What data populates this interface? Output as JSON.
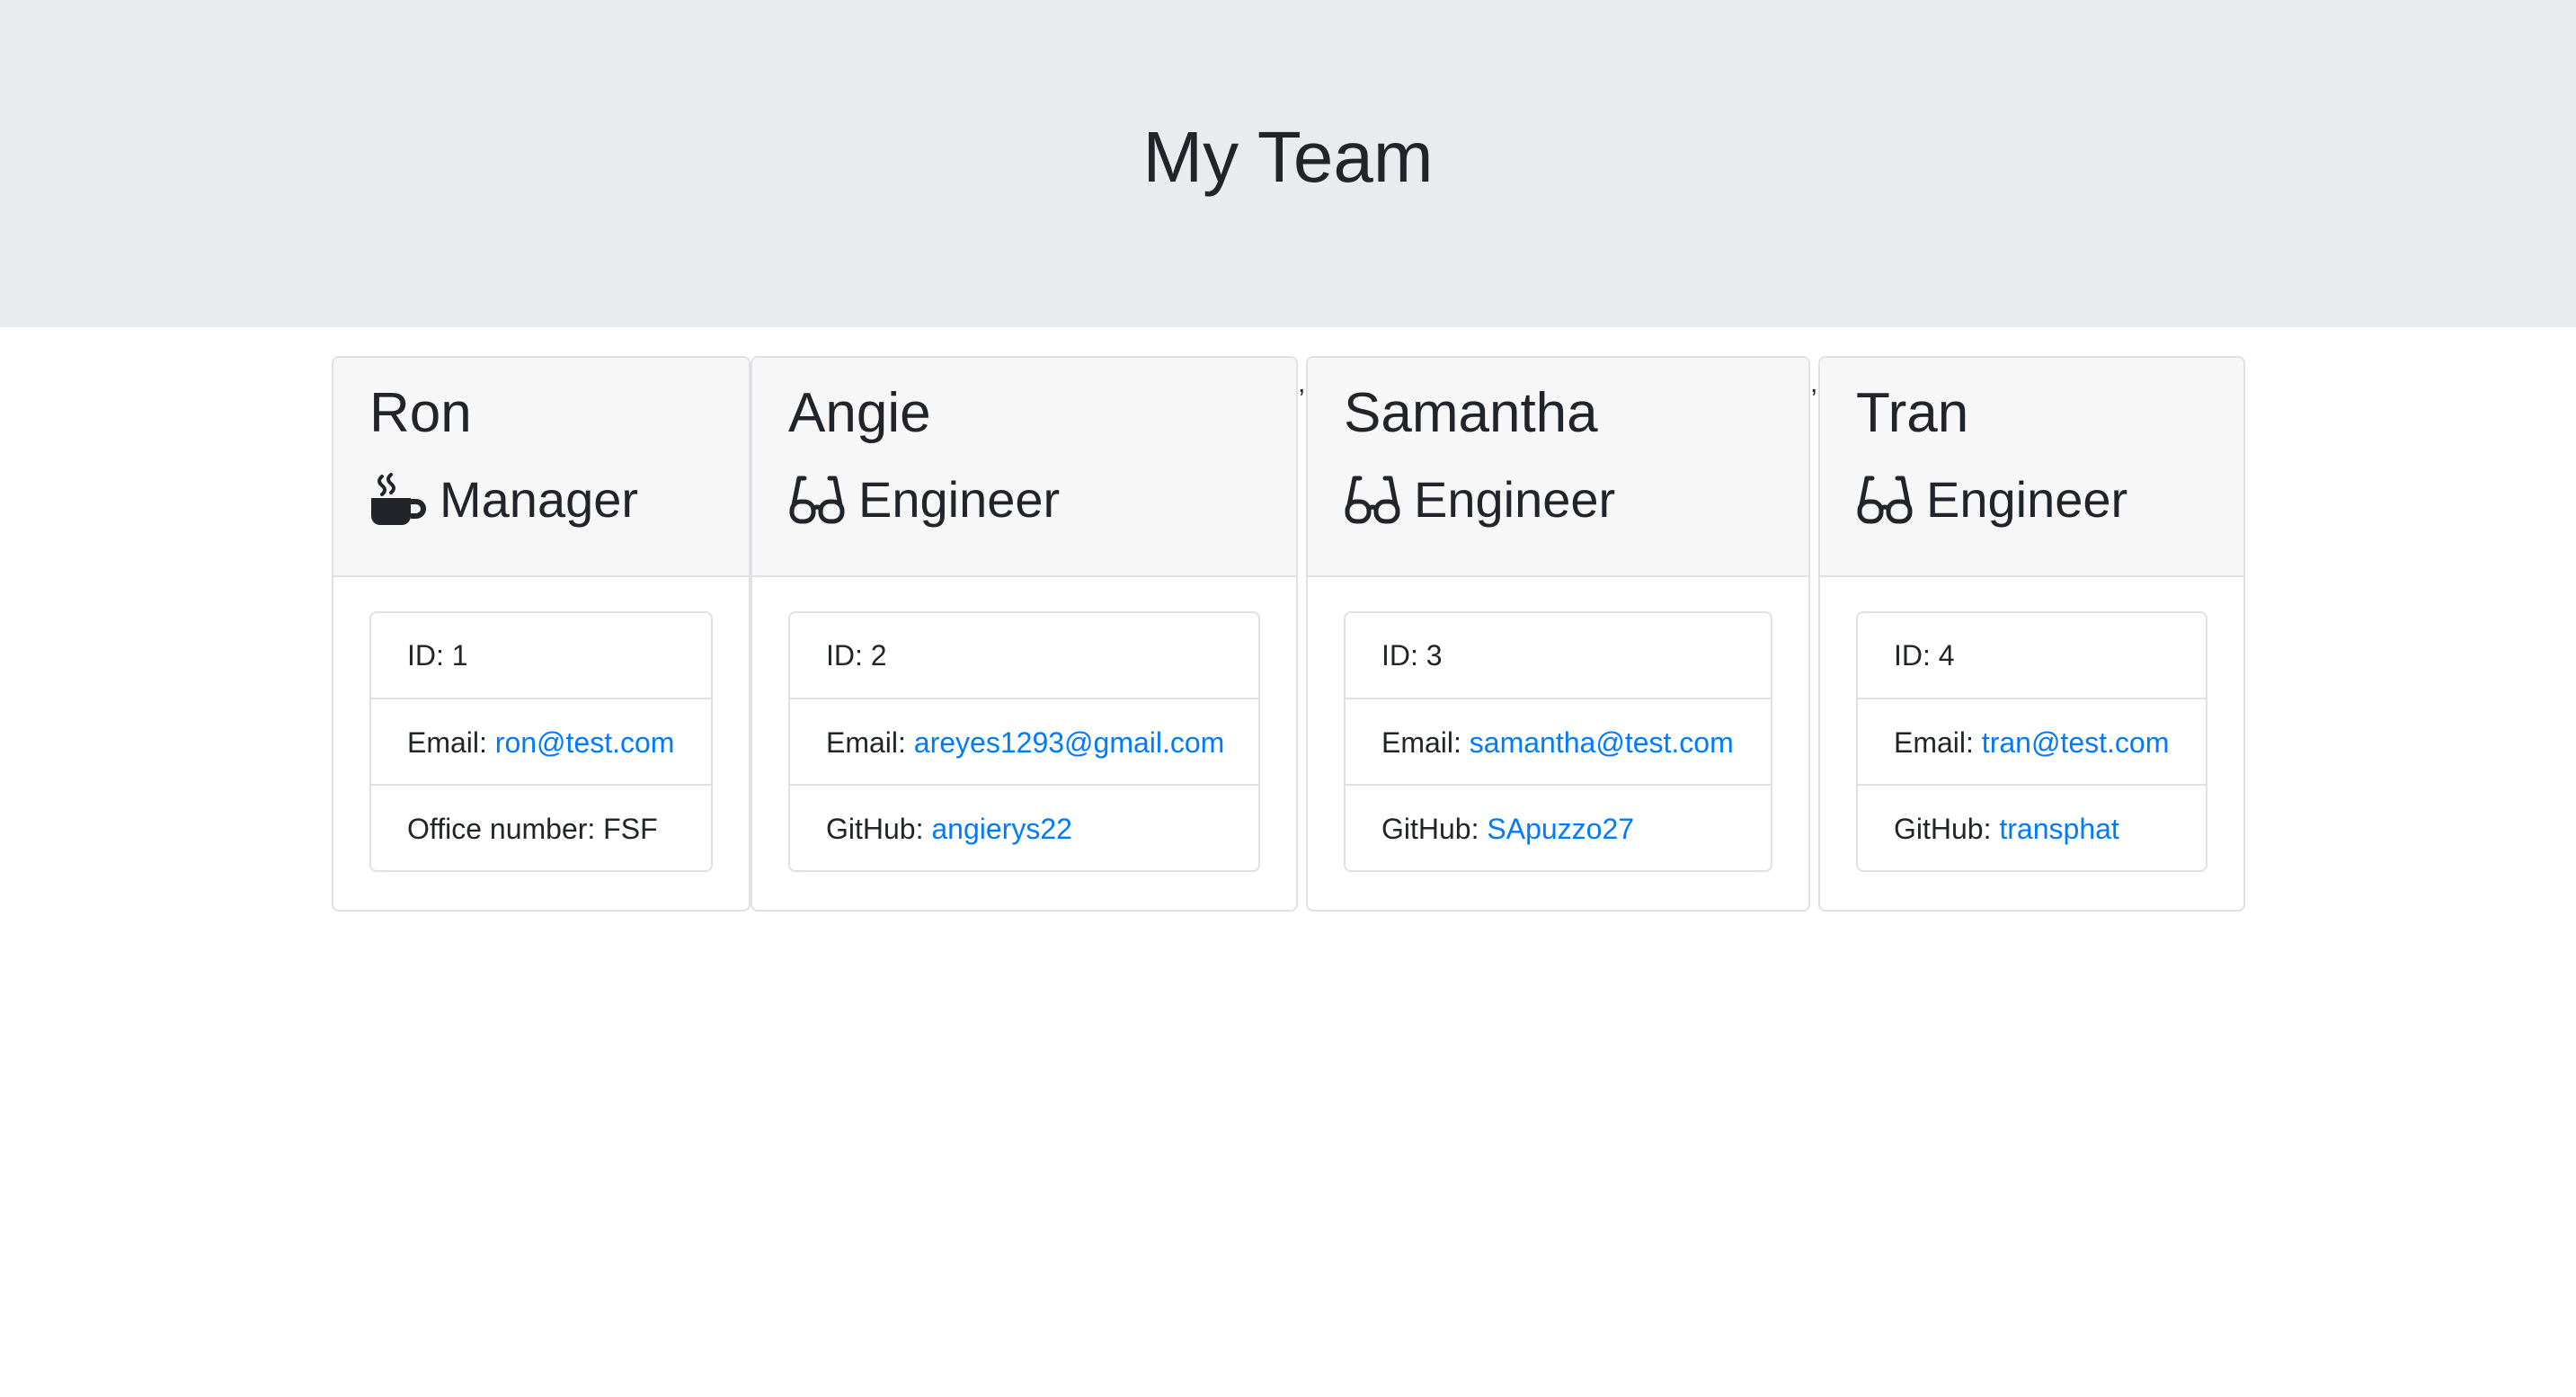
{
  "header": {
    "title": "My Team"
  },
  "team": [
    {
      "name": "Ron",
      "role": "Manager",
      "role_icon": "mug-hot-icon",
      "id_text": "ID: 1",
      "email_label": "Email: ",
      "email": "ron@test.com",
      "extra_label": "Office number: FSF",
      "extra_link": ""
    },
    {
      "name": "Angie",
      "role": "Engineer",
      "role_icon": "glasses-icon",
      "id_text": "ID: 2",
      "email_label": "Email: ",
      "email": "areyes1293@gmail.com",
      "extra_label": "GitHub: ",
      "extra_link": "angierys22"
    },
    {
      "name": "Samantha",
      "role": "Engineer",
      "role_icon": "glasses-icon",
      "id_text": "ID: 3",
      "email_label": "Email: ",
      "email": "samantha@test.com",
      "extra_label": "GitHub: ",
      "extra_link": "SApuzzo27"
    },
    {
      "name": "Tran",
      "role": "Engineer",
      "role_icon": "glasses-icon",
      "id_text": "ID: 4",
      "email_label": "Email: ",
      "email": "tran@test.com",
      "extra_label": "GitHub: ",
      "extra_link": "transphat"
    }
  ],
  "stray_marks": [
    ",",
    ","
  ],
  "colors": {
    "link": "#007bff",
    "jumbotron": "#e9ecef",
    "card_header": "#f7f7f7"
  }
}
